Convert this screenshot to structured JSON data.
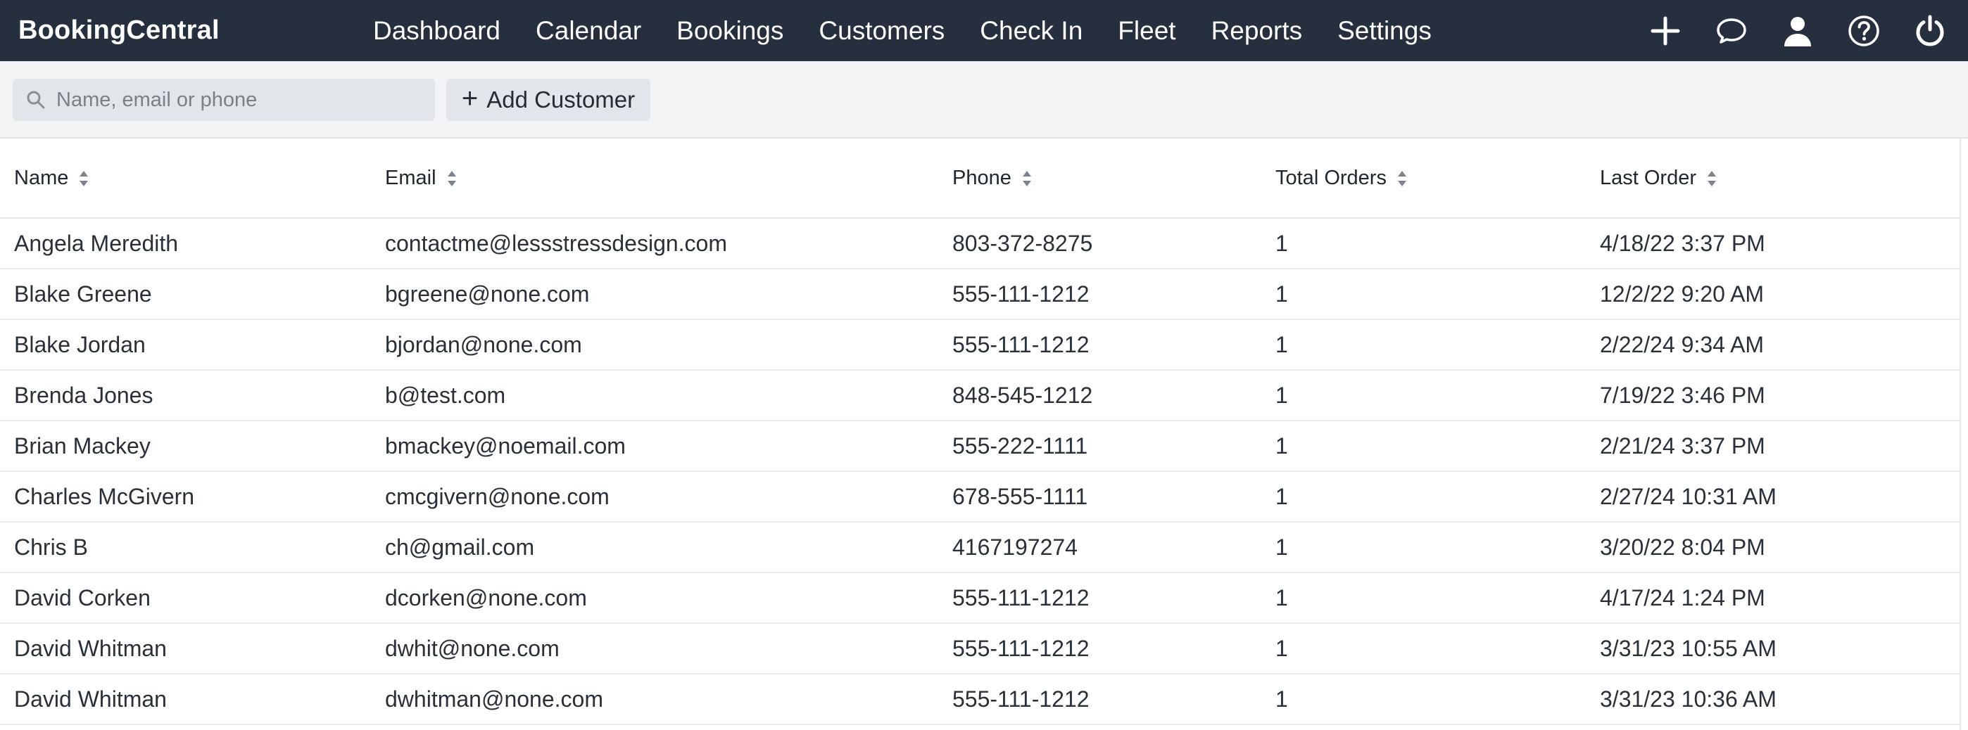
{
  "app": {
    "brand": "BookingCentral"
  },
  "nav": [
    "Dashboard",
    "Calendar",
    "Bookings",
    "Customers",
    "Check In",
    "Fleet",
    "Reports",
    "Settings"
  ],
  "top_icons": [
    "plus-icon",
    "chat-bubble-icon",
    "user-icon",
    "help-icon",
    "power-icon"
  ],
  "toolbar": {
    "search_placeholder": "Name, email or phone",
    "add_label": "Add Customer"
  },
  "table": {
    "columns": [
      "Name",
      "Email",
      "Phone",
      "Total Orders",
      "Last Order"
    ],
    "rows": [
      [
        "Angela Meredith",
        "contactme@lessstressdesign.com",
        "803-372-8275",
        "1",
        "4/18/22 3:37 PM"
      ],
      [
        "Blake Greene",
        "bgreene@none.com",
        "555-111-1212",
        "1",
        "12/2/22 9:20 AM"
      ],
      [
        "Blake Jordan",
        "bjordan@none.com",
        "555-111-1212",
        "1",
        "2/22/24 9:34 AM"
      ],
      [
        "Brenda Jones",
        "b@test.com",
        "848-545-1212",
        "1",
        "7/19/22 3:46 PM"
      ],
      [
        "Brian Mackey",
        "bmackey@noemail.com",
        "555-222-1111",
        "1",
        "2/21/24 3:37 PM"
      ],
      [
        "Charles McGivern",
        "cmcgivern@none.com",
        "678-555-1111",
        "1",
        "2/27/24 10:31 AM"
      ],
      [
        "Chris B",
        "ch@gmail.com",
        "4167197274",
        "1",
        "3/20/22 8:04 PM"
      ],
      [
        "David Corken",
        "dcorken@none.com",
        "555-111-1212",
        "1",
        "4/17/24 1:24 PM"
      ],
      [
        "David Whitman",
        "dwhit@none.com",
        "555-111-1212",
        "1",
        "3/31/23 10:55 AM"
      ],
      [
        "David Whitman",
        "dwhitman@none.com",
        "555-111-1212",
        "1",
        "3/31/23 10:36 AM"
      ]
    ]
  },
  "colors": {
    "topbar": "#252f3e",
    "toolbar": "#f3f4f6",
    "input_bg": "#e2e5e9"
  }
}
